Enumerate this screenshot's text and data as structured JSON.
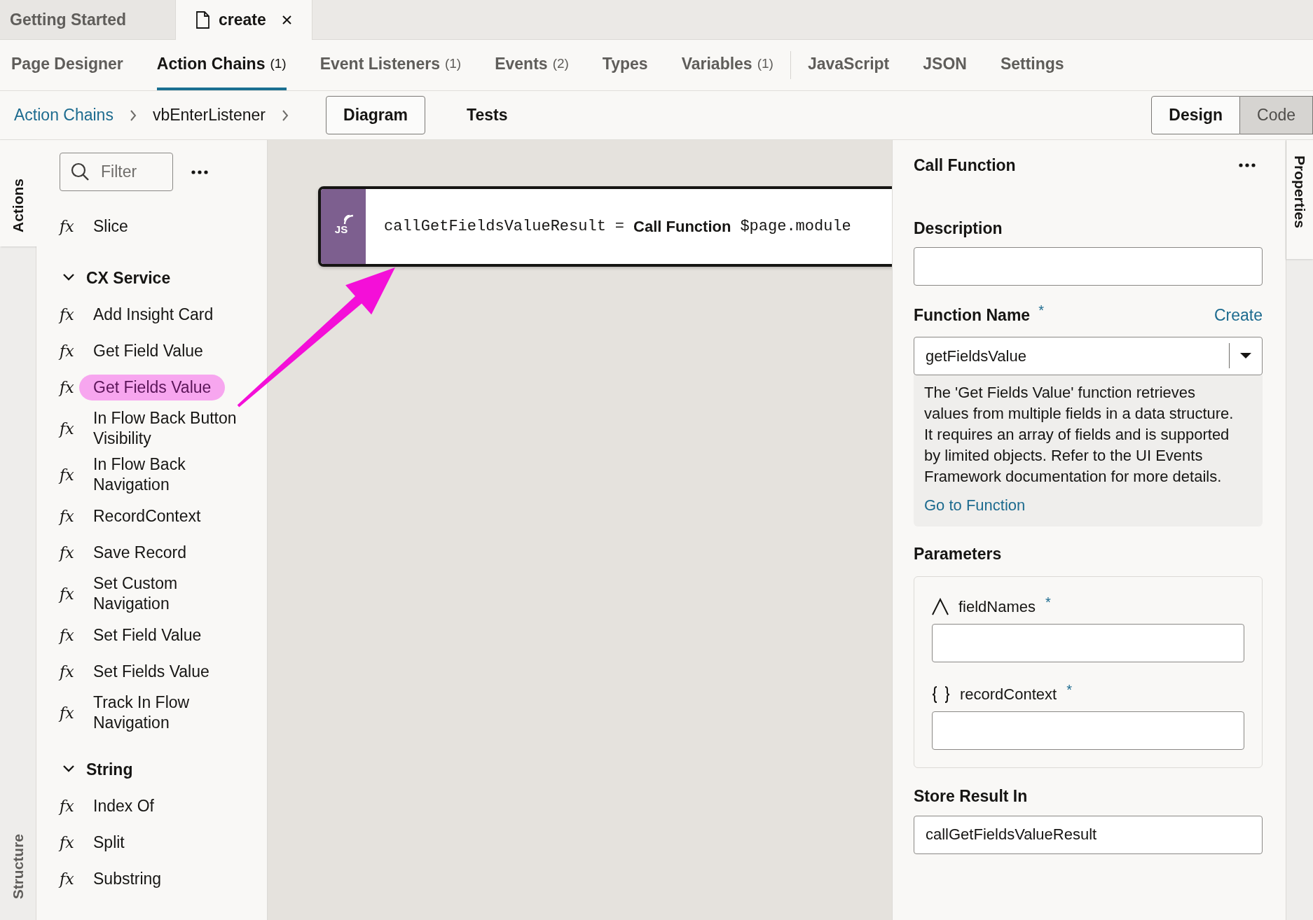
{
  "document_tabs": [
    {
      "label": "Getting Started",
      "selected": false,
      "closable": false
    },
    {
      "label": "create",
      "selected": true,
      "closable": true
    }
  ],
  "editor_tabs": [
    {
      "label": "Page Designer",
      "selected": false,
      "divider_after": false
    },
    {
      "label": "Action Chains",
      "count": "(1)",
      "selected": true,
      "divider_after": false
    },
    {
      "label": "Event Listeners",
      "count": "(1)",
      "selected": false,
      "divider_after": false
    },
    {
      "label": "Events",
      "count": "(2)",
      "selected": false,
      "divider_after": false
    },
    {
      "label": "Types",
      "selected": false,
      "divider_after": false
    },
    {
      "label": "Variables",
      "count": "(1)",
      "selected": false,
      "divider_after": true
    },
    {
      "label": "JavaScript",
      "selected": false,
      "divider_after": false
    },
    {
      "label": "JSON",
      "selected": false,
      "divider_after": false
    },
    {
      "label": "Settings",
      "selected": false,
      "divider_after": false
    }
  ],
  "breadcrumb": [
    {
      "label": "Action Chains",
      "kind": "link"
    },
    {
      "label": "vbEnterListener",
      "kind": "text"
    }
  ],
  "view_tabs": [
    {
      "label": "Diagram",
      "selected": true
    },
    {
      "label": "Tests",
      "selected": false
    }
  ],
  "mode_toggle": [
    {
      "label": "Design",
      "selected": true
    },
    {
      "label": "Code",
      "selected": false
    }
  ],
  "left_rail": [
    {
      "label": "Actions",
      "selected": true
    },
    {
      "label": "Structure",
      "selected": false
    }
  ],
  "actions_panel": {
    "filter": {
      "placeholder": "Filter"
    },
    "items": [
      {
        "icon": "fx",
        "label": "Slice",
        "highlighted": false
      }
    ],
    "groups": [
      {
        "title": "CX Service",
        "expanded": true,
        "items": [
          {
            "icon": "fx",
            "label": "Add Insight Card",
            "highlighted": false
          },
          {
            "icon": "fx",
            "label": "Get Field Value",
            "highlighted": false
          },
          {
            "icon": "fx",
            "label": "Get Fields Value",
            "highlighted": true
          },
          {
            "icon": "fx",
            "label": "In Flow Back Button Visibility",
            "highlighted": false
          },
          {
            "icon": "fx",
            "label": "In Flow Back Navigation",
            "highlighted": false
          },
          {
            "icon": "fx",
            "label": "RecordContext",
            "highlighted": false
          },
          {
            "icon": "fx",
            "label": "Save Record",
            "highlighted": false
          },
          {
            "icon": "fx",
            "label": "Set Custom Navigation",
            "highlighted": false
          },
          {
            "icon": "fx",
            "label": "Set Field Value",
            "highlighted": false
          },
          {
            "icon": "fx",
            "label": "Set Fields Value",
            "highlighted": false
          },
          {
            "icon": "fx",
            "label": "Track In Flow Navigation",
            "highlighted": false
          }
        ]
      },
      {
        "title": "String",
        "expanded": true,
        "items": [
          {
            "icon": "fx",
            "label": "Index Of",
            "highlighted": false
          },
          {
            "icon": "fx",
            "label": "Split",
            "highlighted": false
          },
          {
            "icon": "fx",
            "label": "Substring",
            "highlighted": false
          }
        ]
      }
    ]
  },
  "diagram": {
    "node": {
      "badge": "JS",
      "variable": "callGetFieldsValueResult",
      "operator": "=",
      "action": "Call Function",
      "target": "$page.module"
    }
  },
  "right_rail": [
    {
      "label": "Properties",
      "selected": true
    }
  ],
  "properties": {
    "title": "Call Function",
    "description": {
      "label": "Description"
    },
    "function_name": {
      "label": "Function Name",
      "required_mark": "*",
      "link": "Create",
      "value": "getFieldsValue",
      "help": "The 'Get Fields Value' function retrieves values from multiple fields in a data structure. It requires an array of fields and is supported by limited objects. Refer to the UI Events Framework documentation for more details.",
      "help_link": "Go to Function"
    },
    "parameters": {
      "title": "Parameters",
      "items": [
        {
          "name": "fieldNames",
          "kind": "string",
          "required_mark": "*"
        },
        {
          "name": "recordContext",
          "kind": "object",
          "required_mark": "*"
        }
      ]
    },
    "store_result": {
      "label": "Store Result In",
      "value": "callGetFieldsValueResult"
    }
  }
}
